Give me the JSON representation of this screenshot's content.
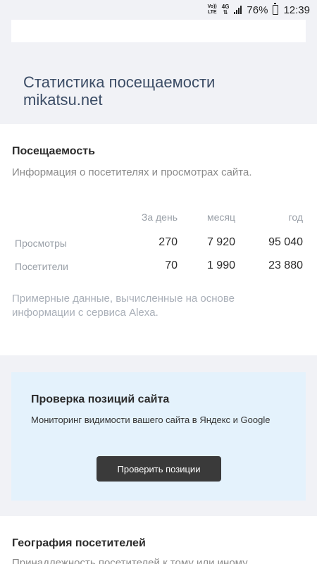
{
  "status_bar": {
    "volte": "Vo)) LTE",
    "network": "4G",
    "battery_percent": "76%",
    "time": "12:39"
  },
  "stats_section": {
    "title_line1": "Статистика посещаемости",
    "title_line2": "mikatsu.net"
  },
  "attendance": {
    "heading": "Посещаемость",
    "description": "Информация о посетителях и просмотрах сайта.",
    "columns": [
      "За день",
      "месяц",
      "год"
    ],
    "rows": [
      {
        "label": "Просмотры",
        "day": "270",
        "month": "7 920",
        "year": "95 040"
      },
      {
        "label": "Посетители",
        "day": "70",
        "month": "1 990",
        "year": "23 880"
      }
    ],
    "note": "Примерные данные, вычисленные на основе информации с сервиса Alexa."
  },
  "promo": {
    "heading": "Проверка позиций сайта",
    "description": "Мониторинг видимости вашего сайта в Яндекс и Google",
    "button_label": "Проверить позиции"
  },
  "geo": {
    "heading": "География посетителей",
    "description": "Принадлежность посетителей к тому или иному"
  }
}
